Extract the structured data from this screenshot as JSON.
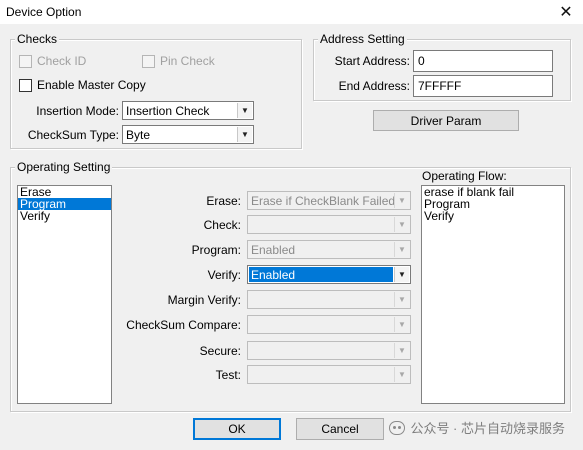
{
  "window": {
    "title": "Device Option",
    "close_glyph": "✕"
  },
  "checks": {
    "title": "Checks",
    "check_id": {
      "label": "Check ID",
      "checked": false,
      "enabled": false
    },
    "pin_check": {
      "label": "Pin Check",
      "checked": false,
      "enabled": false
    },
    "enable_master_copy": {
      "label": "Enable Master Copy",
      "checked": false,
      "enabled": true
    },
    "insertion_mode": {
      "label": "Insertion Mode:",
      "value": "Insertion Check"
    },
    "checksum_type": {
      "label": "CheckSum Type:",
      "value": "Byte"
    }
  },
  "address": {
    "title": "Address Setting",
    "start_label": "Start Address:",
    "start_value": "0",
    "end_label": "End Address:",
    "end_value": "7FFFFF"
  },
  "driver_param_label": "Driver Param",
  "operating": {
    "title": "Operating Setting",
    "list": [
      "Erase",
      "Program",
      "Verify"
    ],
    "selected_index": 1,
    "fields": [
      {
        "label": "Erase:",
        "value": "Erase if CheckBlank Failed",
        "enabled": false
      },
      {
        "label": "Check:",
        "value": "",
        "enabled": false
      },
      {
        "label": "Program:",
        "value": "Enabled",
        "enabled": false
      },
      {
        "label": "Verify:",
        "value": "Enabled",
        "enabled": true
      },
      {
        "label": "Margin Verify:",
        "value": "",
        "enabled": false
      },
      {
        "label": "CheckSum Compare:",
        "value": "",
        "enabled": false
      },
      {
        "label": "Secure:",
        "value": "",
        "enabled": false
      },
      {
        "label": "Test:",
        "value": "",
        "enabled": false
      }
    ],
    "flow_title": "Operating Flow:",
    "flow": [
      "erase if blank fail",
      "Program",
      "Verify"
    ]
  },
  "buttons": {
    "ok": "OK",
    "cancel": "Cancel"
  },
  "watermark": "公众号 · 芯片自动烧录服务",
  "colors": {
    "selection": "#0078d7",
    "dialog_bg": "#f0f0f0"
  },
  "icons": {
    "close": "close-icon",
    "dropdown": "chevron-down-icon",
    "watermark": "wechat-icon"
  }
}
